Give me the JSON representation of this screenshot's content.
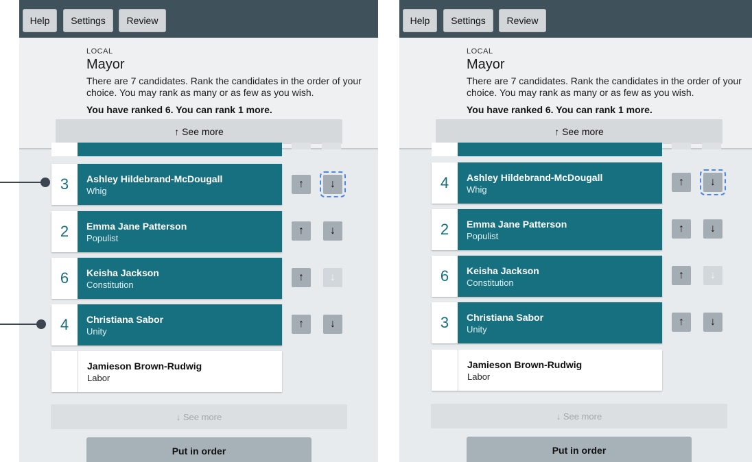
{
  "nav": {
    "help": "Help",
    "settings": "Settings",
    "review": "Review"
  },
  "contest": {
    "category": "LOCAL",
    "title": "Mayor",
    "instructions": "There are 7 candidates. Rank the candidates in the order of your choice. You may rank as many or as few as you wish.",
    "status": "You have ranked 6. You can rank 1 more."
  },
  "see_more_up": "↑ See more",
  "see_more_down": "↓ See more",
  "put_in_order": "Put in order",
  "arrows": {
    "up": "↑",
    "down": "↓"
  },
  "colors": {
    "accent": "#16707f",
    "topbar": "#3f525c",
    "focus": "#4a86e8"
  },
  "panels": [
    {
      "candidates": [
        {
          "rank": "3",
          "name": "Ashley Hildebrand-McDougall",
          "party": "Whig"
        },
        {
          "rank": "2",
          "name": "Emma Jane Patterson",
          "party": "Populist"
        },
        {
          "rank": "6",
          "name": "Keisha Jackson",
          "party": "Constitution"
        },
        {
          "rank": "4",
          "name": "Christiana Sabor",
          "party": "Unity"
        },
        {
          "rank": "",
          "name": "Jamieson Brown-Rudwig",
          "party": "Labor"
        }
      ]
    },
    {
      "candidates": [
        {
          "rank": "4",
          "name": "Ashley Hildebrand-McDougall",
          "party": "Whig"
        },
        {
          "rank": "2",
          "name": "Emma Jane Patterson",
          "party": "Populist"
        },
        {
          "rank": "6",
          "name": "Keisha Jackson",
          "party": "Constitution"
        },
        {
          "rank": "3",
          "name": "Christiana Sabor",
          "party": "Unity"
        },
        {
          "rank": "",
          "name": "Jamieson Brown-Rudwig",
          "party": "Labor"
        }
      ]
    }
  ]
}
